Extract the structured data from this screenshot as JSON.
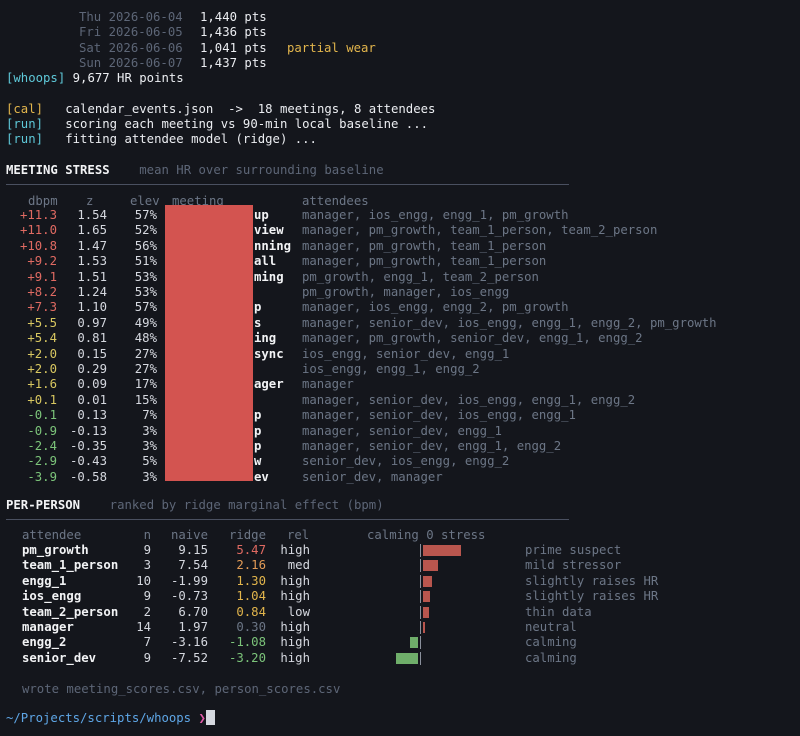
{
  "daily": [
    {
      "day": "Thu 2026-06-04",
      "pts": "1,440 pts",
      "note": ""
    },
    {
      "day": "Fri 2026-06-05",
      "pts": "1,436 pts",
      "note": ""
    },
    {
      "day": "Sat 2026-06-06",
      "pts": "1,041 pts",
      "note": "partial wear"
    },
    {
      "day": "Sun 2026-06-07",
      "pts": "1,437 pts",
      "note": ""
    }
  ],
  "whoops_line": {
    "tag": "[whoops]",
    "text": "9,677 HR points"
  },
  "log": [
    {
      "tag": "[cal]",
      "text": "calendar_events.json  ->  18 meetings, 8 attendees"
    },
    {
      "tag": "[run]",
      "text": "scoring each meeting vs 90-min local baseline ..."
    },
    {
      "tag": "[run]",
      "text": "fitting attendee model (ridge) ..."
    }
  ],
  "meeting_section": {
    "title": "MEETING STRESS",
    "subtitle": "mean HR over surrounding baseline"
  },
  "meeting_headers": {
    "dbpm": "dbpm",
    "z": "z",
    "elev": "elev",
    "meeting": "meeting",
    "attendees": "attendees"
  },
  "meetings": [
    {
      "dbpm": "+11.3",
      "z": "1.54",
      "elev": "57%",
      "meeting_tail": "up",
      "attendees": "manager, ios_engg, engg_1, pm_growth",
      "color": "#e06a62"
    },
    {
      "dbpm": "+11.0",
      "z": "1.65",
      "elev": "52%",
      "meeting_tail": "view",
      "attendees": "manager, pm_growth, team_1_person, team_2_person",
      "color": "#e06a62"
    },
    {
      "dbpm": "+10.8",
      "z": "1.47",
      "elev": "56%",
      "meeting_tail": "nning",
      "attendees": "manager, pm_growth, team_1_person",
      "color": "#e06a62"
    },
    {
      "dbpm": "+9.2",
      "z": "1.53",
      "elev": "51%",
      "meeting_tail": "all",
      "attendees": "manager, pm_growth, team_1_person",
      "color": "#e06a62"
    },
    {
      "dbpm": "+9.1",
      "z": "1.51",
      "elev": "53%",
      "meeting_tail": "ming",
      "attendees": "pm_growth, engg_1, team_2_person",
      "color": "#e06a62"
    },
    {
      "dbpm": "+8.2",
      "z": "1.24",
      "elev": "53%",
      "meeting_tail": "",
      "attendees": "pm_growth, manager, ios_engg",
      "color": "#e06a62"
    },
    {
      "dbpm": "+7.3",
      "z": "1.10",
      "elev": "57%",
      "meeting_tail": "p",
      "attendees": "manager, ios_engg, engg_2, pm_growth",
      "color": "#e06a62"
    },
    {
      "dbpm": "+5.5",
      "z": "0.97",
      "elev": "49%",
      "meeting_tail": "s",
      "attendees": "manager, senior_dev, ios_engg, engg_1, engg_2, pm_growth",
      "color": "#d8c760"
    },
    {
      "dbpm": "+5.4",
      "z": "0.81",
      "elev": "48%",
      "meeting_tail": "ing",
      "attendees": "manager, pm_growth, senior_dev, engg_1, engg_2",
      "color": "#d8c760"
    },
    {
      "dbpm": "+2.0",
      "z": "0.15",
      "elev": "27%",
      "meeting_tail": "sync",
      "attendees": "ios_engg, senior_dev, engg_1",
      "color": "#d8c760"
    },
    {
      "dbpm": "+2.0",
      "z": "0.29",
      "elev": "27%",
      "meeting_tail": "",
      "attendees": "ios_engg, engg_1, engg_2",
      "color": "#d8c760"
    },
    {
      "dbpm": "+1.6",
      "z": "0.09",
      "elev": "17%",
      "meeting_tail": "ager",
      "attendees": "manager",
      "color": "#d8c760"
    },
    {
      "dbpm": "+0.1",
      "z": "0.01",
      "elev": "15%",
      "meeting_tail": "",
      "attendees": "manager, senior_dev, ios_engg, engg_1, engg_2",
      "color": "#d8c760"
    },
    {
      "dbpm": "-0.1",
      "z": "0.13",
      "elev": "7%",
      "meeting_tail": "p",
      "attendees": "manager, senior_dev, ios_engg, engg_1",
      "color": "#7cc47a"
    },
    {
      "dbpm": "-0.9",
      "z": "-0.13",
      "elev": "3%",
      "meeting_tail": "p",
      "attendees": "manager, senior_dev, engg_1",
      "color": "#7cc47a"
    },
    {
      "dbpm": "-2.4",
      "z": "-0.35",
      "elev": "3%",
      "meeting_tail": "p",
      "attendees": "manager, senior_dev, engg_1, engg_2",
      "color": "#7cc47a"
    },
    {
      "dbpm": "-2.9",
      "z": "-0.43",
      "elev": "5%",
      "meeting_tail": "w",
      "attendees": "senior_dev, ios_engg, engg_2",
      "color": "#7cc47a"
    },
    {
      "dbpm": "-3.9",
      "z": "-0.58",
      "elev": "3%",
      "meeting_tail": "ev",
      "attendees": "senior_dev, manager",
      "color": "#7cc47a"
    }
  ],
  "person_section": {
    "title": "PER-PERSON",
    "subtitle": "ranked by ridge marginal effect (bpm)"
  },
  "person_headers": {
    "attendee": "attendee",
    "n": "n",
    "naive": "naive",
    "ridge": "ridge",
    "rel": "rel",
    "scale": "calming 0 stress"
  },
  "persons": [
    {
      "name": "pm_growth",
      "n": "9",
      "naive": "9.15",
      "ridge": "5.47",
      "ridge_value": 5.47,
      "rel": "high",
      "label": "prime suspect",
      "ridge_color": "#e06a62"
    },
    {
      "name": "team_1_person",
      "n": "3",
      "naive": "7.54",
      "ridge": "2.16",
      "ridge_value": 2.16,
      "rel": "med",
      "label": "mild stressor",
      "ridge_color": "#e29b56"
    },
    {
      "name": "engg_1",
      "n": "10",
      "naive": "-1.99",
      "ridge": "1.30",
      "ridge_value": 1.3,
      "rel": "high",
      "label": "slightly raises HR",
      "ridge_color": "#e2b54c"
    },
    {
      "name": "ios_engg",
      "n": "9",
      "naive": "-0.73",
      "ridge": "1.04",
      "ridge_value": 1.04,
      "rel": "high",
      "label": "slightly raises HR",
      "ridge_color": "#e2b54c"
    },
    {
      "name": "team_2_person",
      "n": "2",
      "naive": "6.70",
      "ridge": "0.84",
      "ridge_value": 0.84,
      "rel": "low",
      "label": "thin data",
      "ridge_color": "#e2b54c"
    },
    {
      "name": "manager",
      "n": "14",
      "naive": "1.97",
      "ridge": "0.30",
      "ridge_value": 0.3,
      "rel": "high",
      "label": "neutral",
      "ridge_color": "#6c7686"
    },
    {
      "name": "engg_2",
      "n": "7",
      "naive": "-3.16",
      "ridge": "-1.08",
      "ridge_value": -1.08,
      "rel": "high",
      "label": "calming",
      "ridge_color": "#7cc47a"
    },
    {
      "name": "senior_dev",
      "n": "9",
      "naive": "-7.52",
      "ridge": "-3.20",
      "ridge_value": -3.2,
      "rel": "high",
      "label": "calming",
      "ridge_color": "#7cc47a"
    }
  ],
  "bar_colors": {
    "positive": "#b9564e",
    "negative": "#6fae6a"
  },
  "footer": "wrote meeting_scores.csv, person_scores.csv",
  "prompt": {
    "path": "~/Projects/scripts/whoops",
    "arrow": "❯"
  }
}
